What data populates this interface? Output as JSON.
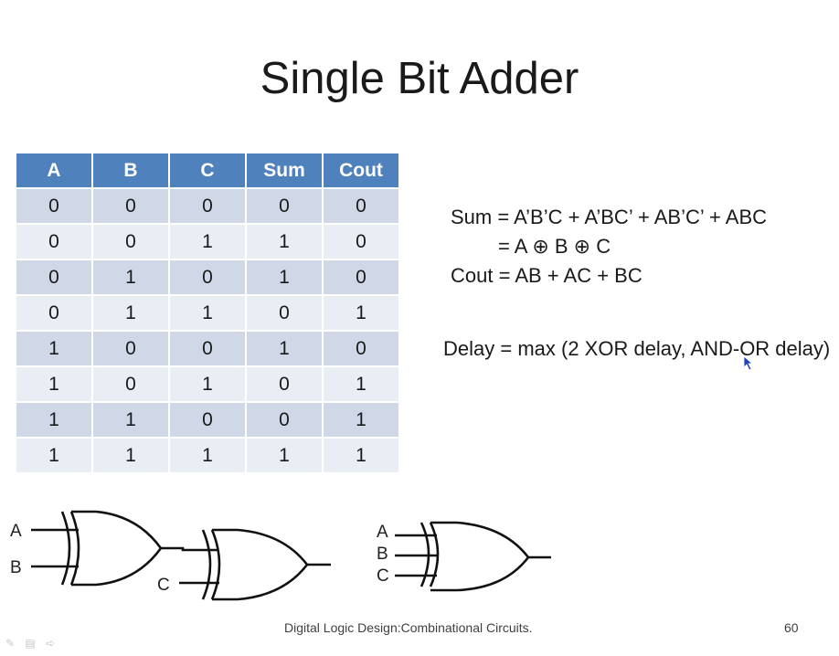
{
  "slide": {
    "title": "Single Bit Adder",
    "footer_text": "Digital Logic Design:Combinational Circuits.",
    "page_number": "60"
  },
  "truth_table": {
    "headers": [
      "A",
      "B",
      "C",
      "Sum",
      "Cout"
    ],
    "rows": [
      [
        "0",
        "0",
        "0",
        "0",
        "0"
      ],
      [
        "0",
        "0",
        "1",
        "1",
        "0"
      ],
      [
        "0",
        "1",
        "0",
        "1",
        "0"
      ],
      [
        "0",
        "1",
        "1",
        "0",
        "1"
      ],
      [
        "1",
        "0",
        "0",
        "1",
        "0"
      ],
      [
        "1",
        "0",
        "1",
        "0",
        "1"
      ],
      [
        "1",
        "1",
        "0",
        "0",
        "1"
      ],
      [
        "1",
        "1",
        "1",
        "1",
        "1"
      ]
    ]
  },
  "equations": {
    "sum_line1": "Sum = A’B’C + A’BC’ + AB’C’ + ABC",
    "sum_line2": "= A ⊕ B ⊕ C",
    "cout": "Cout = AB + AC + BC",
    "delay": "Delay = max (2 XOR delay, AND-OR delay)"
  },
  "circuit_labels": {
    "left_a": "A",
    "left_b": "B",
    "left_c": "C",
    "right_a": "A",
    "right_b": "B",
    "right_c": "C"
  },
  "icons": [
    "pen-icon",
    "slides-icon",
    "arrow-right-icon",
    "mouse-cursor-icon"
  ],
  "colors": {
    "header_blue": "#4f81bd",
    "row_dark": "#d0d8e8",
    "row_light": "#e9edf4",
    "cursor_blue": "#1f3fbf"
  }
}
